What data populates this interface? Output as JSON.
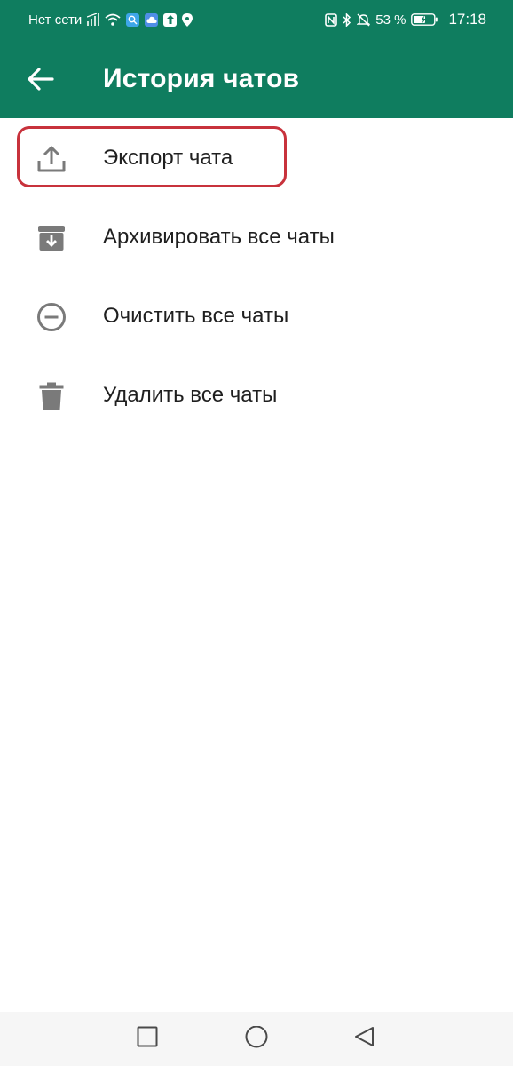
{
  "status_bar": {
    "network": "Нет сети",
    "battery": "53 %",
    "time": "17:18",
    "left_icons": [
      "signal-icon",
      "wifi-icon",
      "search-app-icon",
      "cloud-app-icon",
      "upload-app-icon",
      "location-icon"
    ],
    "right_icons": [
      "nfc-icon",
      "bluetooth-icon",
      "bell-muted-icon",
      "battery-icon"
    ]
  },
  "app_bar": {
    "title": "История чатов",
    "background": "#0f7d5f"
  },
  "menu": {
    "items": [
      {
        "label": "Экспорт чата",
        "icon": "export-icon"
      },
      {
        "label": "Архивировать все чаты",
        "icon": "archive-icon"
      },
      {
        "label": "Очистить все чаты",
        "icon": "clear-icon"
      },
      {
        "label": "Удалить все чаты",
        "icon": "delete-icon"
      }
    ]
  },
  "highlight_color": "#c8323c",
  "nav_bar": {
    "buttons": [
      "recent-apps-icon",
      "home-icon",
      "back-nav-icon"
    ]
  }
}
